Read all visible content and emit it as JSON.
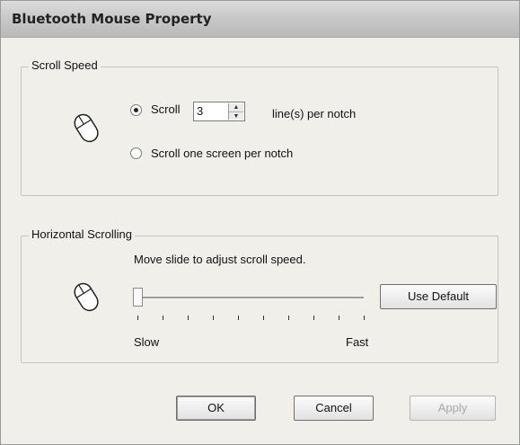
{
  "window": {
    "title": "Bluetooth Mouse Property"
  },
  "scroll_speed": {
    "legend": "Scroll Speed",
    "option_scroll_label": "Scroll",
    "lines_value": "3",
    "lines_suffix": "line(s) per notch",
    "option_screen_label": "Scroll one screen per notch",
    "selected": "scroll"
  },
  "horizontal_scrolling": {
    "legend": "Horizontal Scrolling",
    "instruction": "Move slide to adjust scroll speed.",
    "use_default_label": "Use Default",
    "slow_label": "Slow",
    "fast_label": "Fast",
    "slider_fraction": 0.0,
    "tick_count": 10
  },
  "buttons": {
    "ok": "OK",
    "cancel": "Cancel",
    "apply": "Apply"
  },
  "icons": [
    "mouse-icon",
    "spin-up-icon",
    "spin-down-icon"
  ]
}
